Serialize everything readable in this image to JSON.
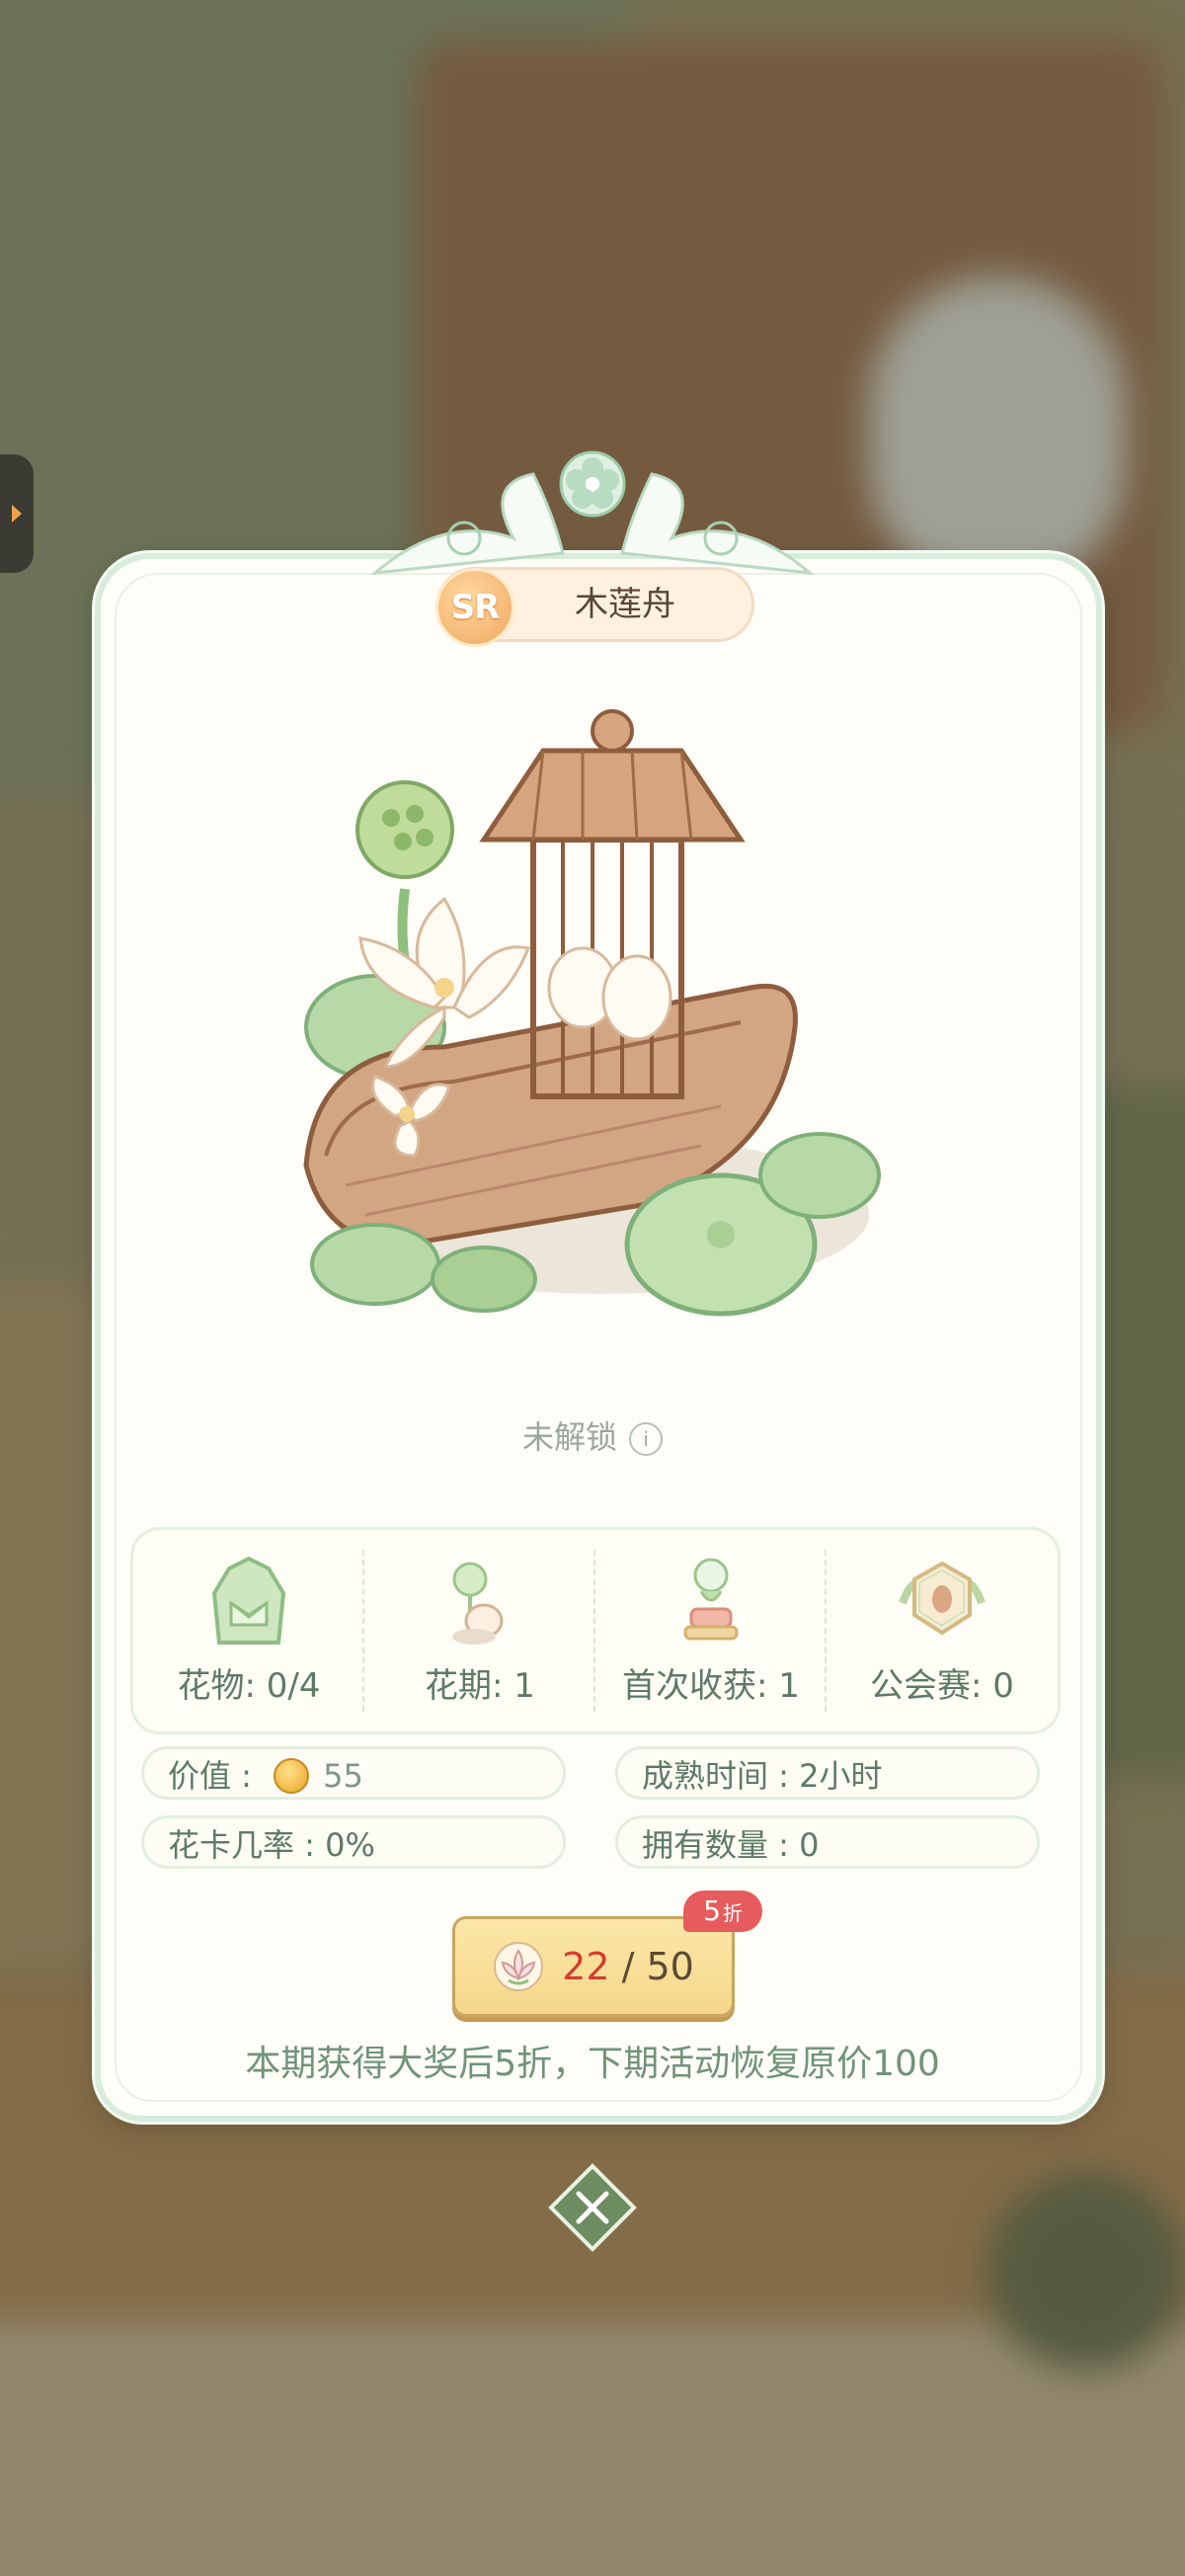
{
  "item": {
    "rarity": "SR",
    "name": "木莲舟",
    "lock_status": "未解锁",
    "info_icon": "i"
  },
  "stats": [
    {
      "label": "花物: 0/4",
      "icon": "flower-item-icon"
    },
    {
      "label": "花期: 1",
      "icon": "bloom-period-icon"
    },
    {
      "label": "首次收获: 1",
      "icon": "first-harvest-icon"
    },
    {
      "label": "公会赛: 0",
      "icon": "guild-race-icon"
    }
  ],
  "details": {
    "value_label": "价值 :",
    "value": "55",
    "mature_time": "成熟时间 : 2小时",
    "card_rate": "花卡几率 : 0%",
    "owned": "拥有数量 : 0"
  },
  "purchase": {
    "current": "22",
    "separator": " / ",
    "total": "50",
    "discount_num": "5",
    "discount_unit": "折"
  },
  "note": "本期获得大奖后5折，下期活动恢复原价100",
  "colors": {
    "panel_bg": "#fffdf8",
    "accent_green": "#5d7a65",
    "button_gold": "#f5d78a",
    "discount_red": "#e65c5c",
    "price_red": "#d63b2f"
  }
}
